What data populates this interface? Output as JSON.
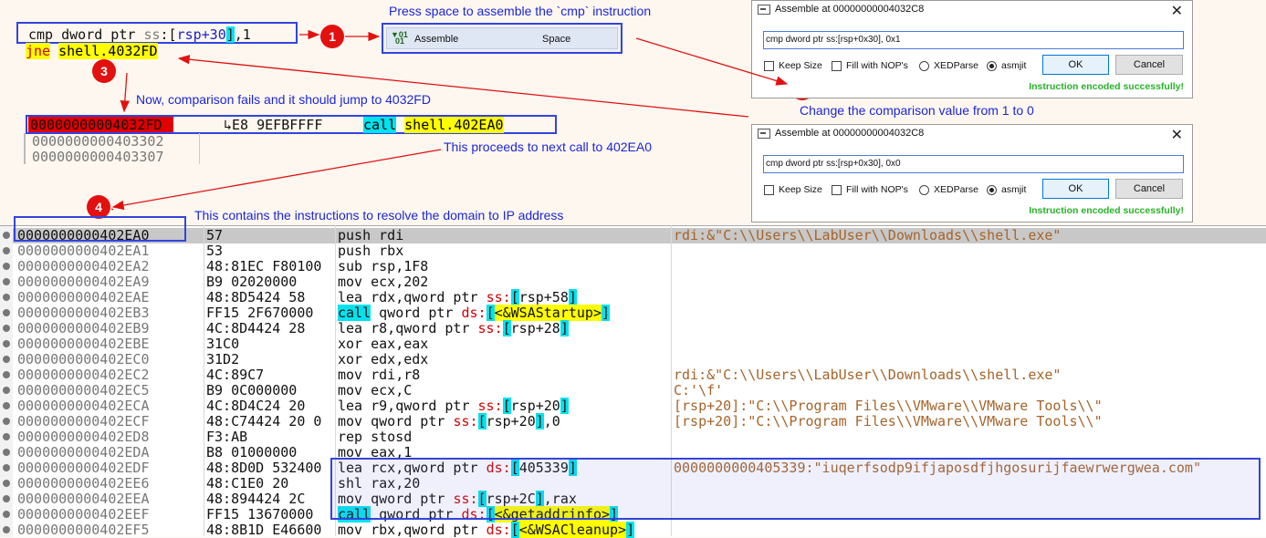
{
  "top": {
    "cmp_parts": [
      "cmp",
      "dword ptr",
      "ss",
      ":[",
      "rsp+30",
      "]",
      ",1"
    ],
    "jne_parts": [
      "jne",
      "shell.4032FD"
    ]
  },
  "markers": [
    "1",
    "2",
    "3",
    "4"
  ],
  "captions": {
    "press_space": "Press space to assemble the `cmp` instruction",
    "change_value": "Change the comparison value from 1 to 0",
    "comparison_fails": "Now, comparison fails and it should jump to 4032FD",
    "proceeds": "This proceeds to next call to 402EA0",
    "resolve": "This contains the instructions to resolve the domain to IP address"
  },
  "menu": {
    "label": "Assemble",
    "shortcut": "Space",
    "icon": "assemble-icon"
  },
  "dialogs": [
    {
      "title": "Assemble at 00000000004032C8",
      "input": "cmp dword ptr ss:[rsp+0x30], 0x1",
      "keep_size": "Keep Size",
      "fill_nops": "Fill with NOP's",
      "xedparse": "XEDParse",
      "asmjit": "asmjit",
      "ok": "OK",
      "cancel": "Cancel",
      "status": "Instruction encoded successfully!"
    },
    {
      "title": "Assemble at 00000000004032C8",
      "input": "cmp dword ptr ss:[rsp+0x30], 0x0",
      "keep_size": "Keep Size",
      "fill_nops": "Fill with NOP's",
      "xedparse": "XEDParse",
      "asmjit": "asmjit",
      "ok": "OK",
      "cancel": "Cancel",
      "status": "Instruction encoded successfully!"
    }
  ],
  "jump_area": {
    "target_addr": "00000000004032FD",
    "target_bytes": "E8 9EFBFFFF",
    "call_parts": [
      "call",
      "shell.402EA0"
    ],
    "next1": "0000000000403302",
    "next2": "0000000000403307"
  },
  "disasm": [
    {
      "addr": "0000000000402EA0",
      "bytes": "57",
      "instr": "push rdi",
      "comment": "rdi:&\"C:\\\\Users\\\\LabUser\\\\Downloads\\\\shell.exe\""
    },
    {
      "addr": "0000000000402EA1",
      "bytes": "53",
      "instr": "push rbx",
      "comment": ""
    },
    {
      "addr": "0000000000402EA2",
      "bytes": "48:81EC F80100",
      "instr": "sub rsp,1F8",
      "comment": ""
    },
    {
      "addr": "0000000000402EA9",
      "bytes": "B9 02020000",
      "instr": "mov ecx,202",
      "comment": ""
    },
    {
      "addr": "0000000000402EAE",
      "bytes": "48:8D5424 58",
      "instr": "lea rdx,qword ptr ss:[rsp+58]",
      "comment": ""
    },
    {
      "addr": "0000000000402EB3",
      "bytes": "FF15 2F670000",
      "instr": "call qword ptr ds:[<&WSAStartup>]",
      "comment": ""
    },
    {
      "addr": "0000000000402EB9",
      "bytes": "4C:8D4424 28",
      "instr": "lea r8,qword ptr ss:[rsp+28]",
      "comment": ""
    },
    {
      "addr": "0000000000402EBE",
      "bytes": "31C0",
      "instr": "xor eax,eax",
      "comment": ""
    },
    {
      "addr": "0000000000402EC0",
      "bytes": "31D2",
      "instr": "xor edx,edx",
      "comment": ""
    },
    {
      "addr": "0000000000402EC2",
      "bytes": "4C:89C7",
      "instr": "mov rdi,r8",
      "comment": "rdi:&\"C:\\\\Users\\\\LabUser\\\\Downloads\\\\shell.exe\""
    },
    {
      "addr": "0000000000402EC5",
      "bytes": "B9 0C000000",
      "instr": "mov ecx,C",
      "comment": "C:'\\f'"
    },
    {
      "addr": "0000000000402ECA",
      "bytes": "4C:8D4C24 20",
      "instr": "lea r9,qword ptr ss:[rsp+20]",
      "comment": "[rsp+20]:\"C:\\\\Program Files\\\\VMware\\\\VMware Tools\\\\\""
    },
    {
      "addr": "0000000000402ECF",
      "bytes": "48:C74424 20 0",
      "instr": "mov qword ptr ss:[rsp+20],0",
      "comment": "[rsp+20]:\"C:\\\\Program Files\\\\VMware\\\\VMware Tools\\\\\""
    },
    {
      "addr": "0000000000402ED8",
      "bytes": "F3:AB",
      "instr": "rep stosd",
      "comment": ""
    },
    {
      "addr": "0000000000402EDA",
      "bytes": "B8 01000000",
      "instr": "mov eax,1",
      "comment": ""
    },
    {
      "addr": "0000000000402EDF",
      "bytes": "48:8D0D 532400",
      "instr": "lea rcx,qword ptr ds:[405339]",
      "comment": "0000000000405339:\"iuqerfsodp9ifjaposdfjhgosurijfaewrwergwea.com\""
    },
    {
      "addr": "0000000000402EE6",
      "bytes": "48:C1E0 20",
      "instr": "shl rax,20",
      "comment": ""
    },
    {
      "addr": "0000000000402EEA",
      "bytes": "48:894424 2C",
      "instr": "mov qword ptr ss:[rsp+2C],rax",
      "comment": ""
    },
    {
      "addr": "0000000000402EEF",
      "bytes": "FF15 13670000",
      "instr": "call qword ptr ds:[<&getaddrinfo>]",
      "comment": ""
    },
    {
      "addr": "0000000000402EF5",
      "bytes": "48:8B1D E46600",
      "instr": "mov rbx,qword ptr ds:[<&WSACleanup>]",
      "comment": ""
    }
  ],
  "colors": {
    "register_highlight": "#00e3ef",
    "symbol_highlight": "#ffff00",
    "annotation_blue": "#1c26d8",
    "marker_red": "#e31010",
    "success_green": "#27b227"
  }
}
